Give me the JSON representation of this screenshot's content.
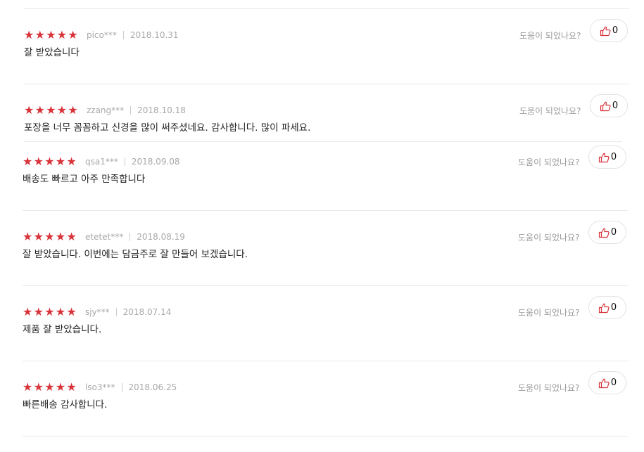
{
  "helpful_label": "도움이 되었나요?",
  "star_glyph": "★",
  "accent_color": "#d8333a",
  "reviews": [
    {
      "rating": 5,
      "user": "pico***",
      "date": "2018.10.31",
      "text": "잘 받았습니다",
      "likes": "0"
    },
    {
      "rating": 5,
      "user": "zzang***",
      "date": "2018.10.18",
      "text": "포장을 너무 꼼꼼하고 신경을 많이 써주셨네요. 감사합니다. 많이 파세요.",
      "likes": "0"
    },
    {
      "rating": 5,
      "user": "qsa1***",
      "date": "2018.09.08",
      "text": "배송도 빠르고 아주 만족합니다",
      "likes": "0"
    },
    {
      "rating": 5,
      "user": "etetet***",
      "date": "2018.08.19",
      "text": "잘 받았습니다. 이번에는 담금주로 잘 만들어 보겠습니다.",
      "likes": "0"
    },
    {
      "rating": 5,
      "user": "sjy***",
      "date": "2018.07.14",
      "text": "제품 잘 받았습니다.",
      "likes": "0"
    },
    {
      "rating": 5,
      "user": "lso3***",
      "date": "2018.06.25",
      "text": "빠른배송 감사합니다.",
      "likes": "0"
    }
  ]
}
